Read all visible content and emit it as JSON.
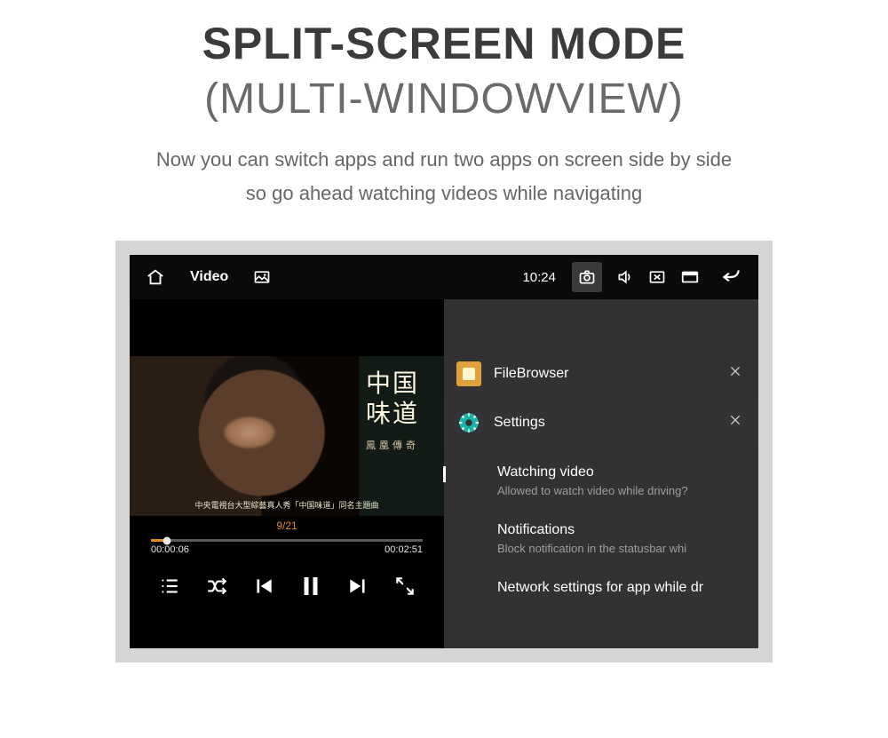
{
  "header": {
    "title": "SPLIT-SCREEN MODE",
    "subtitle": "(MULTI-WINDOWVIEW)",
    "desc_line1": "Now you can switch apps and run two apps on screen side by side",
    "desc_line2": "so go ahead watching videos while navigating"
  },
  "statusbar": {
    "title": "Video",
    "time": "10:24"
  },
  "video": {
    "overlay_cn_line1": "中国",
    "overlay_cn_line2": "味道",
    "overlay_cn_sub": "鳳凰傳奇",
    "caption": "中央電視台大型綜藝真人秀「中国味道」同名主題曲",
    "counter": "9/21",
    "elapsed": "00:00:06",
    "total": "00:02:51"
  },
  "right": {
    "app1": {
      "name": "FileBrowser"
    },
    "app2": {
      "name": "Settings"
    },
    "items": [
      {
        "title": "Watching video",
        "desc": "Allowed to watch video while driving?"
      },
      {
        "title": "Notifications",
        "desc": "Block notification in the statusbar whi"
      },
      {
        "title": "Network settings for app while dr",
        "desc": ""
      }
    ]
  }
}
